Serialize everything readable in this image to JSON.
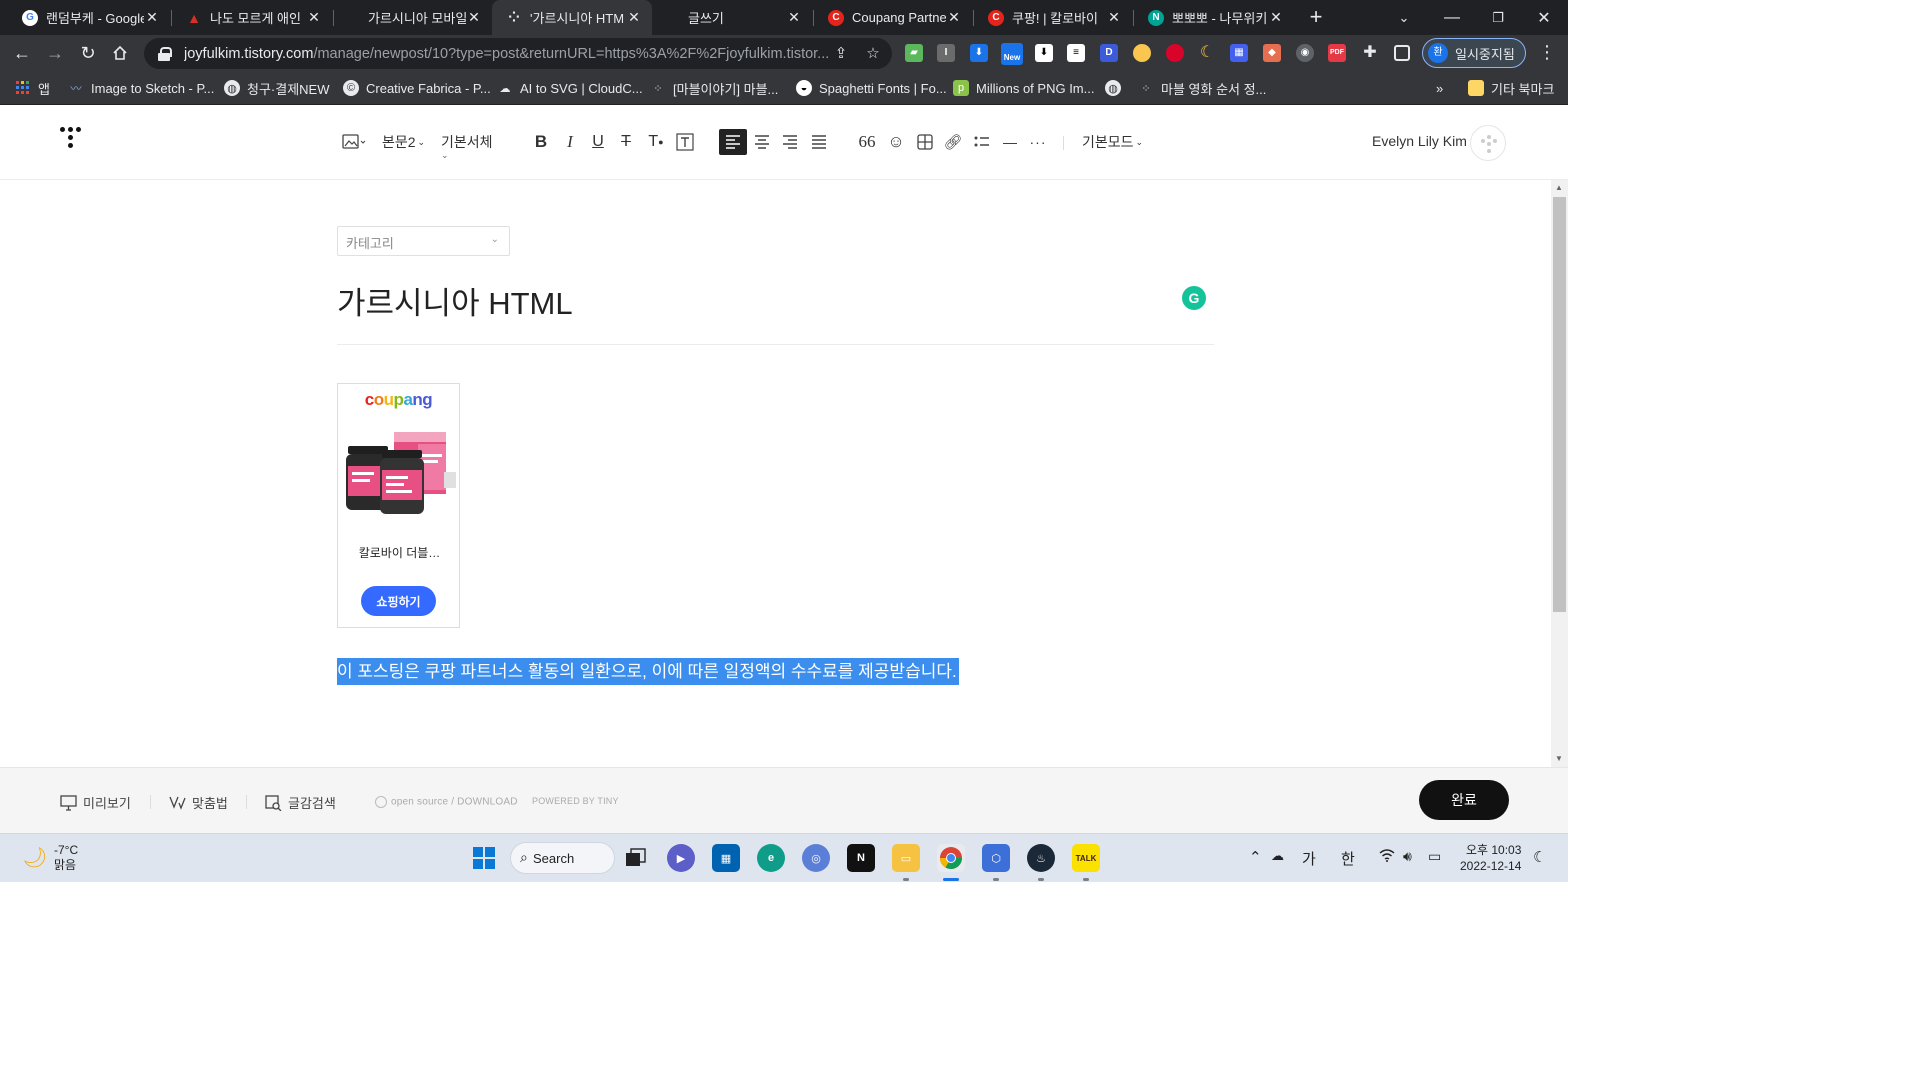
{
  "browser": {
    "tabs": [
      {
        "title": "랜덤부케 - Google",
        "fav_color": "#ffffff",
        "fav_letter": "G",
        "fav_text": "#4285f4"
      },
      {
        "title": "나도 모르게 애인",
        "fav_color": "#d93025",
        "fav_letter": "▲",
        "fav_text": "#fff"
      },
      {
        "title": "가르시니아 모바일",
        "fav_color": "#202124",
        "fav_letter": "",
        "fav_text": "#fff"
      },
      {
        "title": "'가르시니아 HTM",
        "fav_color": "#35363a",
        "fav_letter": "⁘",
        "fav_text": "#e8eaed"
      },
      {
        "title": "글쓰기",
        "fav_color": "#202124",
        "fav_letter": "",
        "fav_text": "#fff"
      },
      {
        "title": "Coupang Partners",
        "fav_color": "#e5251c",
        "fav_letter": "C",
        "fav_text": "#fff"
      },
      {
        "title": "쿠팡! | 칼로바이",
        "fav_color": "#e5251c",
        "fav_letter": "C",
        "fav_text": "#fff"
      },
      {
        "title": "뽀뽀뽀 - 나무위키",
        "fav_color": "#00a495",
        "fav_letter": "N",
        "fav_text": "#fff"
      }
    ],
    "url_host": "joyfulkim.tistory.com",
    "url_path": "/manage/newpost/10?type=post&returnURL=https%3A%2F%2Fjoyfulkim.tistor...",
    "profile_label": "일시중지됨",
    "profile_initial": "환",
    "ext_new_badge": "New"
  },
  "bookmarks": [
    {
      "label": "앱",
      "icon": "apps-grid-icon"
    },
    {
      "label": "Image to Sketch - P...",
      "icon": "sketch-icon"
    },
    {
      "label": "청구·결제NEW",
      "icon": "globe-icon"
    },
    {
      "label": "Creative Fabrica - P...",
      "icon": "creative-fabrica-icon"
    },
    {
      "label": "AI to SVG | CloudC...",
      "icon": "cloud-icon"
    },
    {
      "label": "[마블이야기] 마블...",
      "icon": "tistory-icon"
    },
    {
      "label": "Spaghetti Fonts | Fo...",
      "icon": "font-icon"
    },
    {
      "label": "Millions of PNG Im...",
      "icon": "png-icon"
    },
    {
      "label": "",
      "icon": "globe-icon"
    },
    {
      "label": "마블 영화 순서 정...",
      "icon": "tistory-icon"
    }
  ],
  "bookmarks_more": "»",
  "bookmarks_other": "기타 북마크",
  "editor": {
    "toolbar": {
      "paragraph_style": "본문2",
      "font": "기본서체",
      "mode": "기본모드"
    },
    "user_name": "Evelyn Lily Kim",
    "category_placeholder": "카테고리",
    "post_title": "가르시니아 HTML",
    "product": {
      "brand": [
        "c",
        "o",
        "u",
        "p",
        "a",
        "n",
        "g"
      ],
      "brand_colors": [
        "#e5251c",
        "#f2791c",
        "#f6b415",
        "#86b817",
        "#33a8dc",
        "#4b5bd6",
        "#4b5bd6"
      ],
      "name": "칼로바이 더블…",
      "shop_label": "쇼핑하기"
    },
    "disclosure": "이 포스팅은 쿠팡 파트너스 활동의 일환으로, 이에 따른 일정액의 수수료를 제공받습니다."
  },
  "footer": {
    "preview": "미리보기",
    "spellcheck": "맞춤법",
    "material_search": "글감검색",
    "open_source": "open source / DOWNLOAD",
    "powered_by": "POWERED BY TINY",
    "done": "완료"
  },
  "taskbar": {
    "weather_temp": "-7°C",
    "weather_desc": "맑음",
    "search_label": "Search",
    "ime_1": "가",
    "ime_2": "한",
    "time": "오후 10:03",
    "date": "2022-12-14"
  }
}
